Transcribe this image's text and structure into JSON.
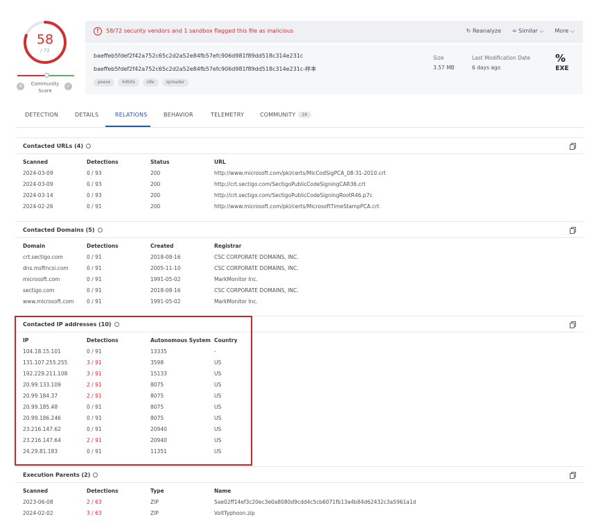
{
  "score": {
    "value": "58",
    "total": "/ 72",
    "malicious": 58,
    "vendors": 72,
    "community_label": "Community Score"
  },
  "banner": {
    "text": "58/72 security vendors and 1 sandbox flagged this file as malicious",
    "actions": [
      "Reanalyze",
      "Similar",
      "More"
    ]
  },
  "file": {
    "hash": "baeffeb5fdef2f42a752c65c2d2a52e84fb57efc906d981f89dd518c314e231c",
    "name": "baeffeb5fdef2f42a752c65c2d2a52e84fb57efc906d981f89dd518c314e231c-样本",
    "tags": [
      "peexe",
      "64bits",
      "idle",
      "spreader"
    ],
    "size_label": "Size",
    "size": "3.57 MB",
    "modified_label": "Last Modification Date",
    "modified": "6 days ago",
    "type": "EXE"
  },
  "tabs": [
    {
      "label": "DETECTION"
    },
    {
      "label": "DETAILS"
    },
    {
      "label": "RELATIONS",
      "active": true
    },
    {
      "label": "BEHAVIOR"
    },
    {
      "label": "TELEMETRY"
    },
    {
      "label": "COMMUNITY",
      "badge": "26"
    }
  ],
  "contacted_urls": {
    "title": "Contacted URLs (4)",
    "columns": [
      "Scanned",
      "Detections",
      "Status",
      "URL"
    ],
    "rows": [
      [
        "2024-03-09",
        "0 / 93",
        "200",
        "http://www.microsoft.com/pki/certs/MicCodSigPCA_08-31-2010.crt"
      ],
      [
        "2024-03-09",
        "0 / 93",
        "200",
        "http://crt.sectigo.com/SectigoPublicCodeSigningCAR36.crt"
      ],
      [
        "2024-03-14",
        "0 / 93",
        "200",
        "http://crt.sectigo.com/SectigoPublicCodeSigningRootR46.p7c"
      ],
      [
        "2024-02-26",
        "0 / 91",
        "200",
        "http://www.microsoft.com/pki/certs/MicrosoftTimeStampPCA.crt"
      ]
    ]
  },
  "contacted_domains": {
    "title": "Contacted Domains (5)",
    "columns": [
      "Domain",
      "Detections",
      "Created",
      "Registrar"
    ],
    "rows": [
      [
        "crt.sectigo.com",
        "0 / 91",
        "2018-08-16",
        "CSC CORPORATE DOMAINS, INC."
      ],
      [
        "dns.msftncsi.com",
        "0 / 91",
        "2005-11-10",
        "CSC CORPORATE DOMAINS, INC."
      ],
      [
        "microsoft.com",
        "0 / 91",
        "1991-05-02",
        "MarkMonitor Inc."
      ],
      [
        "sectigo.com",
        "0 / 91",
        "2018-08-16",
        "CSC CORPORATE DOMAINS, INC."
      ],
      [
        "www.microsoft.com",
        "0 / 91",
        "1991-05-02",
        "MarkMonitor Inc."
      ]
    ]
  },
  "contacted_ips": {
    "title": "Contacted IP addresses (10)",
    "columns": [
      "IP",
      "Detections",
      "Autonomous System",
      "Country"
    ],
    "rows": [
      [
        "104.18.15.101",
        "0 / 91",
        "13335",
        "-"
      ],
      [
        "131.107.255.255",
        "3 / 91",
        "3598",
        "US"
      ],
      [
        "192.229.211.108",
        "3 / 91",
        "15133",
        "US"
      ],
      [
        "20.99.133.109",
        "2 / 91",
        "8075",
        "US"
      ],
      [
        "20.99.184.37",
        "2 / 91",
        "8075",
        "US"
      ],
      [
        "20.99.185.48",
        "0 / 91",
        "8075",
        "US"
      ],
      [
        "20.99.186.246",
        "0 / 91",
        "8075",
        "US"
      ],
      [
        "23.216.147.62",
        "0 / 91",
        "20940",
        "US"
      ],
      [
        "23.216.147.64",
        "2 / 91",
        "20940",
        "US"
      ],
      [
        "24.29.81.183",
        "0 / 91",
        "11351",
        "US"
      ]
    ]
  },
  "execution_parents": {
    "title": "Execution Parents (2)",
    "columns": [
      "Scanned",
      "Detections",
      "Type",
      "Name"
    ],
    "rows": [
      [
        "2023-06-08",
        "2 / 63",
        "ZIP",
        "5ae02ff14ef3c20ec3e0a8080d9cdd4c5cb6071fb13a4b84d62432c3a5961a1d"
      ],
      [
        "2024-02-02",
        "3 / 63",
        "ZIP",
        "VoltTyphoon.zip"
      ]
    ]
  },
  "colors": {
    "malicious": "#d32f2f",
    "accent": "#1a56c8",
    "highlight": "#c62828"
  }
}
